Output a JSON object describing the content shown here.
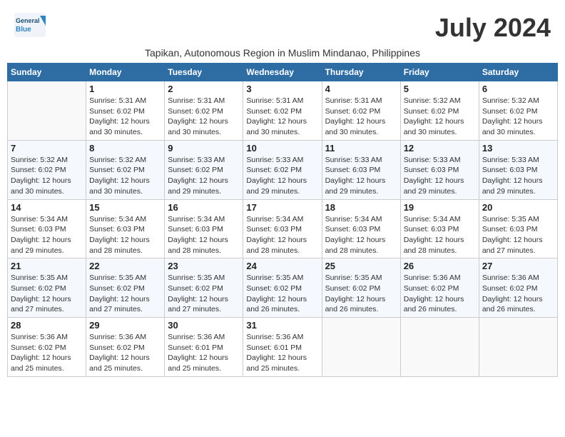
{
  "header": {
    "logo_text_general": "General",
    "logo_text_blue": "Blue",
    "month_year": "July 2024",
    "subtitle": "Tapikan, Autonomous Region in Muslim Mindanao, Philippines"
  },
  "weekdays": [
    "Sunday",
    "Monday",
    "Tuesday",
    "Wednesday",
    "Thursday",
    "Friday",
    "Saturday"
  ],
  "weeks": [
    [
      {
        "day": "",
        "info": ""
      },
      {
        "day": "1",
        "info": "Sunrise: 5:31 AM\nSunset: 6:02 PM\nDaylight: 12 hours\nand 30 minutes."
      },
      {
        "day": "2",
        "info": "Sunrise: 5:31 AM\nSunset: 6:02 PM\nDaylight: 12 hours\nand 30 minutes."
      },
      {
        "day": "3",
        "info": "Sunrise: 5:31 AM\nSunset: 6:02 PM\nDaylight: 12 hours\nand 30 minutes."
      },
      {
        "day": "4",
        "info": "Sunrise: 5:31 AM\nSunset: 6:02 PM\nDaylight: 12 hours\nand 30 minutes."
      },
      {
        "day": "5",
        "info": "Sunrise: 5:32 AM\nSunset: 6:02 PM\nDaylight: 12 hours\nand 30 minutes."
      },
      {
        "day": "6",
        "info": "Sunrise: 5:32 AM\nSunset: 6:02 PM\nDaylight: 12 hours\nand 30 minutes."
      }
    ],
    [
      {
        "day": "7",
        "info": "Sunrise: 5:32 AM\nSunset: 6:02 PM\nDaylight: 12 hours\nand 30 minutes."
      },
      {
        "day": "8",
        "info": "Sunrise: 5:32 AM\nSunset: 6:02 PM\nDaylight: 12 hours\nand 30 minutes."
      },
      {
        "day": "9",
        "info": "Sunrise: 5:33 AM\nSunset: 6:02 PM\nDaylight: 12 hours\nand 29 minutes."
      },
      {
        "day": "10",
        "info": "Sunrise: 5:33 AM\nSunset: 6:02 PM\nDaylight: 12 hours\nand 29 minutes."
      },
      {
        "day": "11",
        "info": "Sunrise: 5:33 AM\nSunset: 6:03 PM\nDaylight: 12 hours\nand 29 minutes."
      },
      {
        "day": "12",
        "info": "Sunrise: 5:33 AM\nSunset: 6:03 PM\nDaylight: 12 hours\nand 29 minutes."
      },
      {
        "day": "13",
        "info": "Sunrise: 5:33 AM\nSunset: 6:03 PM\nDaylight: 12 hours\nand 29 minutes."
      }
    ],
    [
      {
        "day": "14",
        "info": "Sunrise: 5:34 AM\nSunset: 6:03 PM\nDaylight: 12 hours\nand 29 minutes."
      },
      {
        "day": "15",
        "info": "Sunrise: 5:34 AM\nSunset: 6:03 PM\nDaylight: 12 hours\nand 28 minutes."
      },
      {
        "day": "16",
        "info": "Sunrise: 5:34 AM\nSunset: 6:03 PM\nDaylight: 12 hours\nand 28 minutes."
      },
      {
        "day": "17",
        "info": "Sunrise: 5:34 AM\nSunset: 6:03 PM\nDaylight: 12 hours\nand 28 minutes."
      },
      {
        "day": "18",
        "info": "Sunrise: 5:34 AM\nSunset: 6:03 PM\nDaylight: 12 hours\nand 28 minutes."
      },
      {
        "day": "19",
        "info": "Sunrise: 5:34 AM\nSunset: 6:03 PM\nDaylight: 12 hours\nand 28 minutes."
      },
      {
        "day": "20",
        "info": "Sunrise: 5:35 AM\nSunset: 6:03 PM\nDaylight: 12 hours\nand 27 minutes."
      }
    ],
    [
      {
        "day": "21",
        "info": "Sunrise: 5:35 AM\nSunset: 6:02 PM\nDaylight: 12 hours\nand 27 minutes."
      },
      {
        "day": "22",
        "info": "Sunrise: 5:35 AM\nSunset: 6:02 PM\nDaylight: 12 hours\nand 27 minutes."
      },
      {
        "day": "23",
        "info": "Sunrise: 5:35 AM\nSunset: 6:02 PM\nDaylight: 12 hours\nand 27 minutes."
      },
      {
        "day": "24",
        "info": "Sunrise: 5:35 AM\nSunset: 6:02 PM\nDaylight: 12 hours\nand 26 minutes."
      },
      {
        "day": "25",
        "info": "Sunrise: 5:35 AM\nSunset: 6:02 PM\nDaylight: 12 hours\nand 26 minutes."
      },
      {
        "day": "26",
        "info": "Sunrise: 5:36 AM\nSunset: 6:02 PM\nDaylight: 12 hours\nand 26 minutes."
      },
      {
        "day": "27",
        "info": "Sunrise: 5:36 AM\nSunset: 6:02 PM\nDaylight: 12 hours\nand 26 minutes."
      }
    ],
    [
      {
        "day": "28",
        "info": "Sunrise: 5:36 AM\nSunset: 6:02 PM\nDaylight: 12 hours\nand 25 minutes."
      },
      {
        "day": "29",
        "info": "Sunrise: 5:36 AM\nSunset: 6:02 PM\nDaylight: 12 hours\nand 25 minutes."
      },
      {
        "day": "30",
        "info": "Sunrise: 5:36 AM\nSunset: 6:01 PM\nDaylight: 12 hours\nand 25 minutes."
      },
      {
        "day": "31",
        "info": "Sunrise: 5:36 AM\nSunset: 6:01 PM\nDaylight: 12 hours\nand 25 minutes."
      },
      {
        "day": "",
        "info": ""
      },
      {
        "day": "",
        "info": ""
      },
      {
        "day": "",
        "info": ""
      }
    ]
  ]
}
